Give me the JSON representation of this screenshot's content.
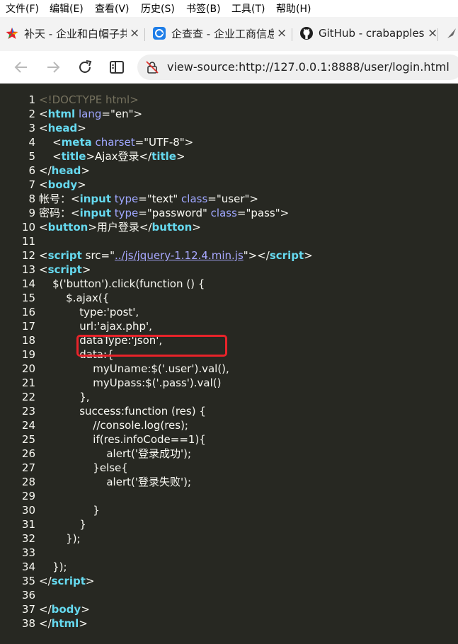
{
  "menu": [
    {
      "label": "文件(F)"
    },
    {
      "label": "编辑(E)"
    },
    {
      "label": "查看(V)"
    },
    {
      "label": "历史(S)"
    },
    {
      "label": "书签(B)"
    },
    {
      "label": "工具(T)"
    },
    {
      "label": "帮助(H)"
    }
  ],
  "tabs": [
    {
      "title": "补天 - 企业和白帽子共",
      "icon": "butian-logo-icon",
      "close": "×"
    },
    {
      "title": "企查查 - 企业工商信息",
      "icon": "qichacha-logo-icon",
      "close": "×"
    },
    {
      "title": "GitHub - crabapples",
      "icon": "github-logo-icon",
      "close": "×"
    }
  ],
  "toolbar": {
    "url": "view-source:http://127.0.0.1:8888/user/login.html"
  },
  "colors": {
    "editor_bg": "#272822",
    "tag": "#66d9ef",
    "highlight_box": "#e8232a"
  },
  "source": {
    "lines": [
      {
        "n": "1",
        "parts": [
          {
            "t": "<!DOCTYPE html>",
            "c": "comment"
          }
        ]
      },
      {
        "n": "2",
        "parts": [
          {
            "t": "<"
          },
          {
            "t": "html",
            "c": "tag"
          },
          {
            "t": " "
          },
          {
            "t": "lang",
            "c": "attr"
          },
          {
            "t": "=\"en\">"
          }
        ]
      },
      {
        "n": "3",
        "parts": [
          {
            "t": "<"
          },
          {
            "t": "head",
            "c": "tag"
          },
          {
            "t": ">"
          }
        ]
      },
      {
        "n": "4",
        "parts": [
          {
            "t": "    <"
          },
          {
            "t": "meta",
            "c": "tag"
          },
          {
            "t": " "
          },
          {
            "t": "charset",
            "c": "attr"
          },
          {
            "t": "=\"UTF-8\">"
          }
        ]
      },
      {
        "n": "5",
        "parts": [
          {
            "t": "    <"
          },
          {
            "t": "title",
            "c": "tag"
          },
          {
            "t": ">Ajax登录</"
          },
          {
            "t": "title",
            "c": "tag"
          },
          {
            "t": ">"
          }
        ]
      },
      {
        "n": "6",
        "parts": [
          {
            "t": "</"
          },
          {
            "t": "head",
            "c": "tag"
          },
          {
            "t": ">"
          }
        ]
      },
      {
        "n": "7",
        "parts": [
          {
            "t": "<"
          },
          {
            "t": "body",
            "c": "tag"
          },
          {
            "t": ">"
          }
        ]
      },
      {
        "n": "8",
        "parts": [
          {
            "t": "帐号：<"
          },
          {
            "t": "input",
            "c": "tag"
          },
          {
            "t": " "
          },
          {
            "t": "type",
            "c": "attr"
          },
          {
            "t": "=\"text\" "
          },
          {
            "t": "class",
            "c": "attr"
          },
          {
            "t": "=\"user\">"
          }
        ]
      },
      {
        "n": "9",
        "parts": [
          {
            "t": "密码：<"
          },
          {
            "t": "input",
            "c": "tag"
          },
          {
            "t": " "
          },
          {
            "t": "type",
            "c": "attr"
          },
          {
            "t": "=\"password\" "
          },
          {
            "t": "class",
            "c": "attr"
          },
          {
            "t": "=\"pass\">"
          }
        ]
      },
      {
        "n": "10",
        "parts": [
          {
            "t": "<"
          },
          {
            "t": "button",
            "c": "tag"
          },
          {
            "t": ">用户登录</"
          },
          {
            "t": "button",
            "c": "tag"
          },
          {
            "t": ">"
          }
        ]
      },
      {
        "n": "11",
        "parts": []
      },
      {
        "n": "12",
        "parts": [
          {
            "t": "<"
          },
          {
            "t": "script",
            "c": "tag"
          },
          {
            "t": " src=\""
          },
          {
            "t": "../js/jquery-1.12.4.min.js",
            "c": "link"
          },
          {
            "t": "\"></"
          },
          {
            "t": "script",
            "c": "tag"
          },
          {
            "t": ">"
          }
        ]
      },
      {
        "n": "13",
        "parts": [
          {
            "t": "<"
          },
          {
            "t": "script",
            "c": "tag"
          },
          {
            "t": ">"
          }
        ]
      },
      {
        "n": "14",
        "parts": [
          {
            "t": "    $('button').click(function () {"
          }
        ]
      },
      {
        "n": "15",
        "parts": [
          {
            "t": "        $.ajax({"
          }
        ]
      },
      {
        "n": "16",
        "parts": [
          {
            "t": "            type:'post',"
          }
        ]
      },
      {
        "n": "17",
        "parts": [
          {
            "t": "            url:'ajax.php',"
          }
        ]
      },
      {
        "n": "18",
        "parts": [
          {
            "t": "            dataType:'json',"
          }
        ]
      },
      {
        "n": "19",
        "parts": [
          {
            "t": "            data:{"
          }
        ]
      },
      {
        "n": "20",
        "parts": [
          {
            "t": "                myUname:$('.user').val(),"
          }
        ]
      },
      {
        "n": "21",
        "parts": [
          {
            "t": "                myUpass:$('.pass').val()"
          }
        ]
      },
      {
        "n": "22",
        "parts": [
          {
            "t": "            },"
          }
        ]
      },
      {
        "n": "23",
        "parts": [
          {
            "t": "            success:function (res) {"
          }
        ]
      },
      {
        "n": "24",
        "parts": [
          {
            "t": "                //console.log(res);"
          }
        ]
      },
      {
        "n": "25",
        "parts": [
          {
            "t": "                if(res.infoCode==1){"
          }
        ]
      },
      {
        "n": "26",
        "parts": [
          {
            "t": "                    alert('登录成功');"
          }
        ]
      },
      {
        "n": "27",
        "parts": [
          {
            "t": "                }else{"
          }
        ]
      },
      {
        "n": "28",
        "parts": [
          {
            "t": "                    alert('登录失败');"
          }
        ]
      },
      {
        "n": "29",
        "parts": []
      },
      {
        "n": "30",
        "parts": [
          {
            "t": "                }"
          }
        ]
      },
      {
        "n": "31",
        "parts": [
          {
            "t": "            }"
          }
        ]
      },
      {
        "n": "32",
        "parts": [
          {
            "t": "        });"
          }
        ]
      },
      {
        "n": "33",
        "parts": []
      },
      {
        "n": "34",
        "parts": [
          {
            "t": "    });"
          }
        ]
      },
      {
        "n": "35",
        "parts": [
          {
            "t": "</"
          },
          {
            "t": "script",
            "c": "tag"
          },
          {
            "t": ">"
          }
        ]
      },
      {
        "n": "36",
        "parts": []
      },
      {
        "n": "37",
        "parts": [
          {
            "t": "</"
          },
          {
            "t": "body",
            "c": "tag"
          },
          {
            "t": ">"
          }
        ]
      },
      {
        "n": "38",
        "parts": [
          {
            "t": "</"
          },
          {
            "t": "html",
            "c": "tag"
          },
          {
            "t": ">"
          }
        ]
      }
    ]
  }
}
